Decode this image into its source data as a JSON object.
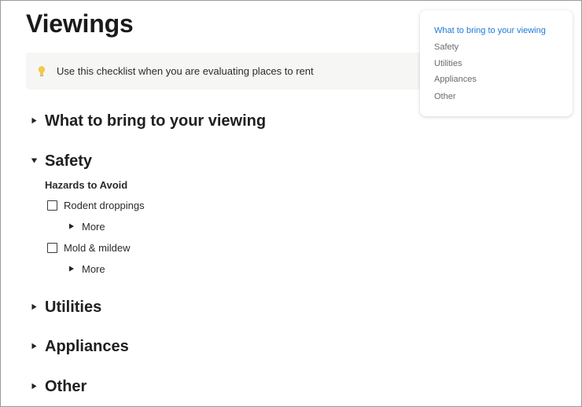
{
  "page": {
    "title": "Viewings"
  },
  "callout": {
    "icon": "lightbulb-icon",
    "text": "Use this checklist when you are evaluating places to rent"
  },
  "sections": [
    {
      "label": "What to bring to your viewing",
      "expanded": false
    },
    {
      "label": "Safety",
      "expanded": true
    },
    {
      "label": "Utilities",
      "expanded": false
    },
    {
      "label": "Appliances",
      "expanded": false
    },
    {
      "label": "Other",
      "expanded": false
    }
  ],
  "safety": {
    "subheading": "Hazards to Avoid",
    "items": [
      {
        "label": "Rodent droppings",
        "checked": false,
        "more_label": "More"
      },
      {
        "label": "Mold & mildew",
        "checked": false,
        "more_label": "More"
      }
    ]
  },
  "toc": {
    "items": [
      {
        "label": "What to bring to your viewing",
        "active": true
      },
      {
        "label": "Safety",
        "active": false
      },
      {
        "label": "Utilities",
        "active": false
      },
      {
        "label": "Appliances",
        "active": false
      },
      {
        "label": "Other",
        "active": false
      }
    ]
  },
  "colors": {
    "accent": "#1e7ad6",
    "callout_bg": "#f6f6f4",
    "bulb": "#f2c94c"
  }
}
